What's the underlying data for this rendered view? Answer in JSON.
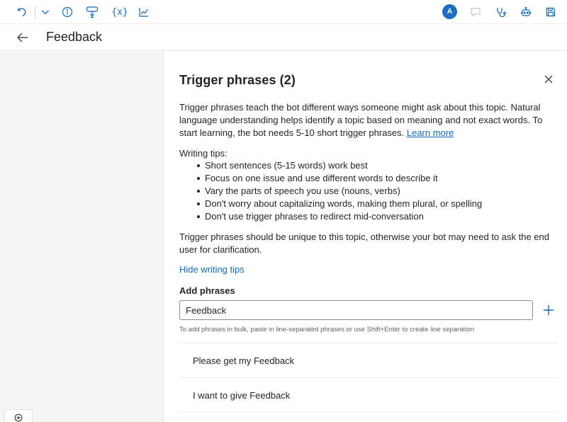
{
  "toolbar": {
    "icons": [
      "undo-icon",
      "chevron-down-icon",
      "info-icon",
      "trigger-icon",
      "variables-icon",
      "analytics-icon",
      "comment-icon",
      "stethoscope-icon",
      "bot-icon",
      "save-icon"
    ],
    "variables_label": "{x}",
    "avatar_initial": "A",
    "accent_color": "#0f6cbd"
  },
  "header": {
    "title": "Feedback"
  },
  "panel": {
    "title": "Trigger phrases (2)",
    "description": "Trigger phrases teach the bot different ways someone might ask about this topic. Natural language understanding helps identify a topic based on meaning and not exact words. To start learning, the bot needs 5-10 short trigger phrases. ",
    "learn_more": "Learn more",
    "tips_label": "Writing tips:",
    "tips": [
      "Short sentences (5-15 words) work best",
      "Focus on one issue and use different words to describe it",
      "Vary the parts of speech you use (nouns, verbs)",
      "Don't worry about capitalizing words, making them plural, or spelling",
      "Don't use trigger phrases to redirect mid-conversation"
    ],
    "unique_note": "Trigger phrases should be unique to this topic, otherwise your bot may need to ask the end user for clarification.",
    "hide_tips": "Hide writing tips",
    "add_label": "Add phrases",
    "input_value": "Feedback",
    "helper_text": "To add phrases in bulk, paste in line-separated phrases or use Shift+Enter to create line separation",
    "phrases": [
      "Please get my Feedback",
      "I want to give Feedback"
    ]
  }
}
